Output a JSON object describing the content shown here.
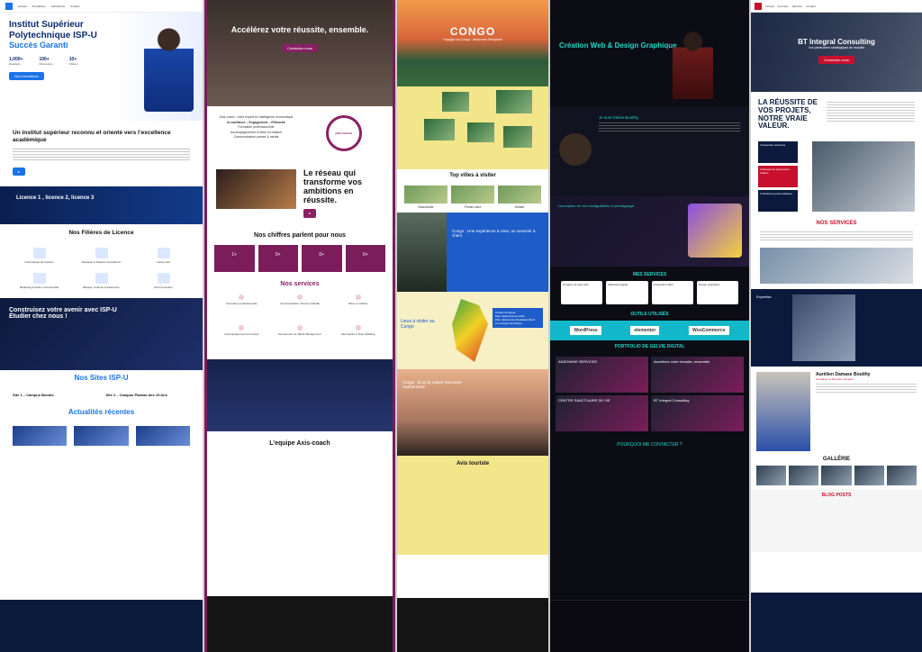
{
  "p1": {
    "hero_line1": "Institut Supérieur",
    "hero_line2": "Polytechnique ISP-U",
    "hero_sub": "Succès Garanti",
    "stats": [
      {
        "v": "1,000+",
        "l": "Étudiants"
      },
      {
        "v": "100+",
        "l": "Partenaires"
      },
      {
        "v": "10+",
        "l": "Filières"
      }
    ],
    "btn": "Nos formations",
    "h2": "Un institut supérieur reconnu et orienté vers l’excellence académique",
    "band": "Licence 1 , licence 2, licence 3",
    "filieres": "Nos Filières de Licence",
    "filiere_items": [
      "Informatique de Gestion",
      "Réseaux & Télécommunications",
      "Génie Civil",
      "Marketing & Action Commerciale",
      "Banque, Finance & Assurance",
      "Droit & Gestion"
    ],
    "construisez": "Construisez votre avenir avec ISP-U",
    "etudier": "Étudier chez nous !",
    "sites": "Nos Sites ISP-U",
    "site1": "Site 1 – Campus Bombo",
    "site2": "Site 2 – Campus Plateau des 15 Ans",
    "actualites": "Actualités récentes"
  },
  "p2": {
    "hero": "Accélérez votre réussite, ensemble.",
    "hero_btn": "Contactez-nous",
    "tags": [
      "Axis coach : votre expert en intelligence économique",
      "la confiance – Engagement – Efficacité",
      "Formation professionnelle",
      "Accompagnement & Mise en relation",
      "Communication presse & média"
    ],
    "badge": "AXIS COACH",
    "reseau": "Le réseau qui transforme vos ambitions en réussite.",
    "chiffres": "Nos chiffres parlent pour nous",
    "stats": [
      "1+",
      "0+",
      "0+",
      "0+"
    ],
    "services": "Nos services",
    "service_items": [
      "Formation professionnelle",
      "Communication, Presse & Média",
      "Mise en relation",
      "Accompagnement & Conseil",
      "Recrutement & Talent Management",
      "Séminaires & Team Building"
    ],
    "equipe": "L’equipe Axis-coach"
  },
  "p3": {
    "hero": "CONGO",
    "hero_sub": "Voyagez au Congo : découvrez l’inexploré",
    "top_villes": "Top villes à visiter",
    "cities": [
      "Brazzaville",
      "Pointe-noire",
      "Dolisie"
    ],
    "blue_text": "Congo : Une expérience à vivre, un souvenir à chérir",
    "lieux": "Lieux à visiter au Congo",
    "lieux_list": [
      "Chutes du Djoué",
      "Parc national de la Léfini",
      "Parc national de Nouabalé-Ndoki",
      "Les Gorges de Diosso"
    ],
    "nature": "Congo : là où la nature rencontre l’authenticité",
    "avis": "Avis touriste"
  },
  "p4": {
    "hero": "Création Web & Design Graphique",
    "about_name": "Je suis Gelvie Bouithy",
    "conception": "Conception de vos montgolfières et prototypage",
    "mes_services": "MES SERVICES",
    "services": [
      "Création de sites web",
      "Marketing digital",
      "Infographie SEO",
      "Design graphique"
    ],
    "outils": "OUTILS UTILISÉS",
    "tools": [
      "WordPress",
      "elementor",
      "WooCommerce"
    ],
    "portfolio": "PORTFOLIO DE GELVIE DIGITAL",
    "port_items": [
      "ANSOWINE SERVICES",
      "Accélérez votre réussite, ensemble",
      "CENTRE SANCTUAIRE DE VIE",
      "BT Integral Consulting"
    ],
    "contact": "POURQUOI ME CONTACTER ?"
  },
  "p5": {
    "hero": "BT Integral Consulting",
    "hero_sub": "Vos partenaires stratégiques de réussite",
    "hero_btn": "Contactez-nous",
    "reussite": "LA RÉUSSITE DE VOS PROJETS, NOTRE VRAIE VALEUR.",
    "cards": [
      "1 Expertise reconnue",
      "2 Réseau de partenaires solides",
      "3 Solutions personnalisées"
    ],
    "nos_services": "NOS SERVICES",
    "expertise": "Expertise",
    "person": "Aurélien Damase Bouithy",
    "person_sub": "Fondateur et Directeur Général",
    "galerie": "GALLÉRIE",
    "blog": "BLOG POSTS"
  }
}
